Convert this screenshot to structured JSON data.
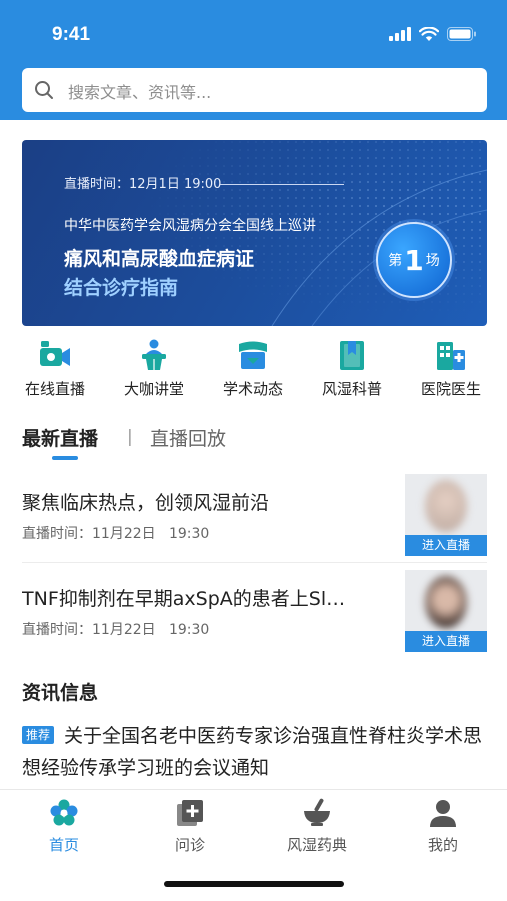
{
  "status": {
    "time": "9:41"
  },
  "search": {
    "placeholder": "搜索文章、资讯等..."
  },
  "banner": {
    "time": "直播时间：12月1日 19:00",
    "org": "中华中医药学会风湿病分会全国线上巡讲",
    "title1": "痛风和高尿酸血症病证",
    "title2": "结合诊疗指南",
    "badge_pre": "第",
    "badge_num": "1",
    "badge_post": "场"
  },
  "nav": [
    {
      "label": "在线直播",
      "icon": "video-camera-icon"
    },
    {
      "label": "大咖讲堂",
      "icon": "lecture-podium-icon"
    },
    {
      "label": "学术动态",
      "icon": "academic-book-icon"
    },
    {
      "label": "风湿科普",
      "icon": "bookmark-book-icon"
    },
    {
      "label": "医院医生",
      "icon": "hospital-building-icon"
    }
  ],
  "tabs": {
    "latest": "最新直播",
    "separator": "|",
    "replay": "直播回放"
  },
  "live": [
    {
      "title": "聚焦临床热点，创领风湿前沿",
      "time": "直播时间：11月22日   19:30",
      "button": "进入直播"
    },
    {
      "title": "TNF抑制剂在早期axSpA的患者上Sl…",
      "time": "直播时间：11月22日   19:30",
      "button": "进入直播"
    }
  ],
  "news": {
    "heading": "资讯信息",
    "tag": "推荐",
    "text": "关于全国名老中医药专家诊治强直性脊柱炎学术思想经验传承学习班的会议通知"
  },
  "tabbar": [
    {
      "label": "首页",
      "icon": "home-flower-icon",
      "active": true
    },
    {
      "label": "问诊",
      "icon": "consult-plus-icon"
    },
    {
      "label": "风湿药典",
      "icon": "mortar-pestle-icon"
    },
    {
      "label": "我的",
      "icon": "profile-user-icon"
    }
  ],
  "colors": {
    "primary": "#2a8ce0",
    "banner": "#1c4d9c",
    "accent_light": "#9fd0ff"
  }
}
